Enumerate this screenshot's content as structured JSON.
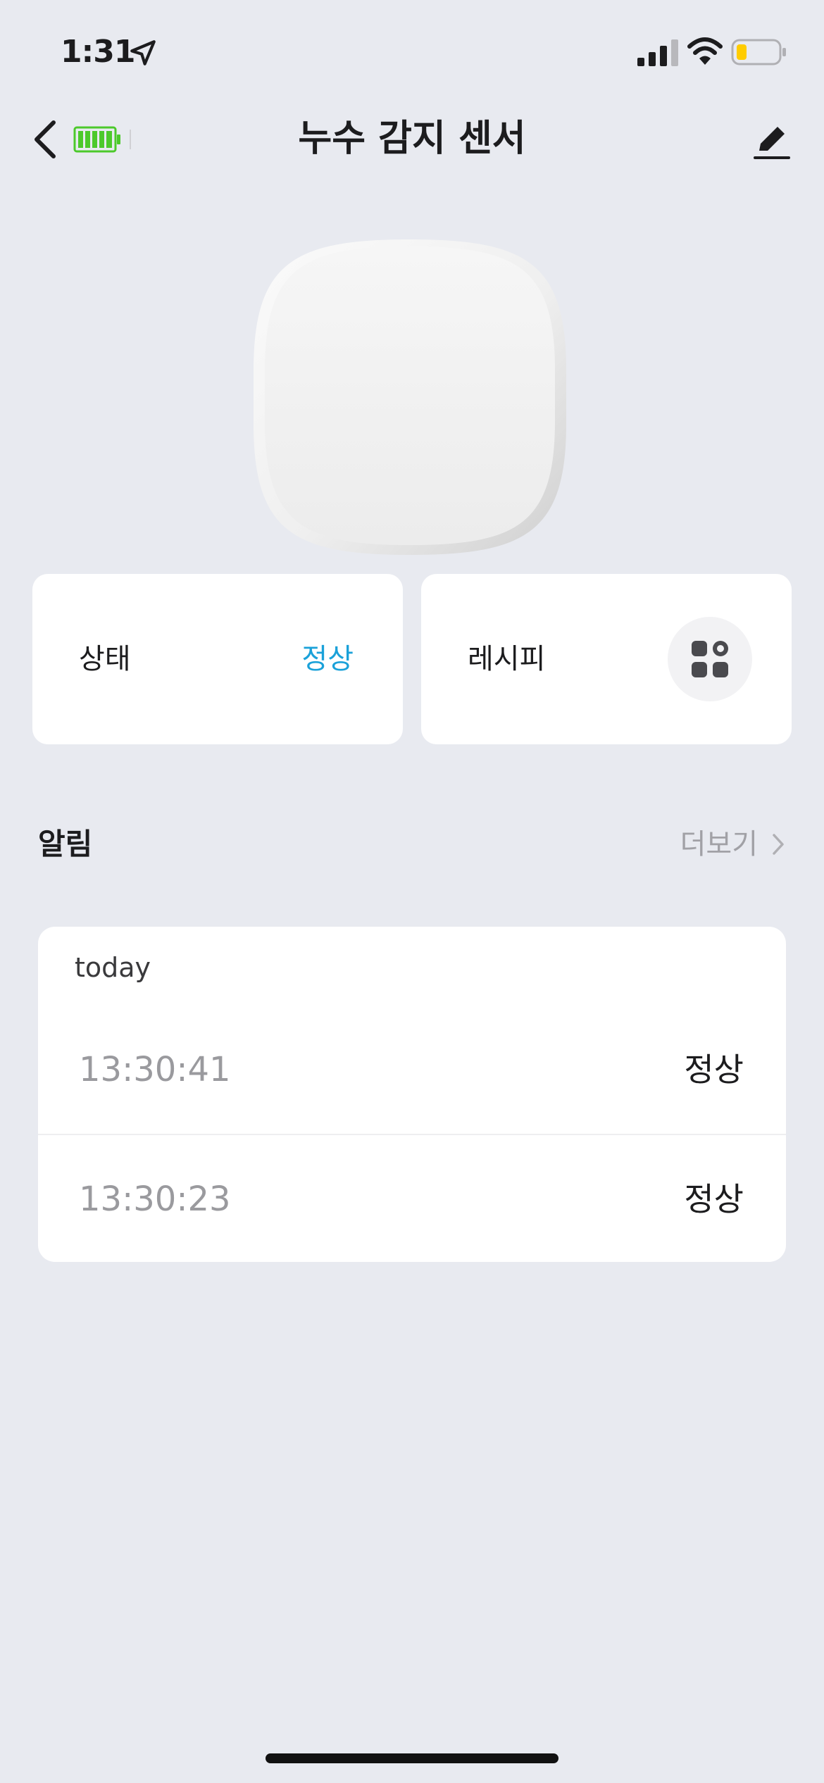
{
  "status_bar": {
    "time": "1:31"
  },
  "header": {
    "title": "누수 감지 센서"
  },
  "cards": {
    "status": {
      "label": "상태",
      "value": "정상",
      "value_color": "#1aa1d9"
    },
    "recipe": {
      "label": "레시피"
    }
  },
  "alerts": {
    "title": "알림",
    "more_label": "더보기",
    "group_label": "today",
    "items": [
      {
        "time": "13:30:41",
        "status": "정상"
      },
      {
        "time": "13:30:23",
        "status": "정상"
      }
    ]
  },
  "icons": {
    "location": "location-arrow-icon",
    "signal": "cellular-signal-icon",
    "wifi": "wifi-icon",
    "battery_status": "battery-low-icon",
    "back": "chevron-left-icon",
    "device_battery": "battery-full-icon",
    "edit": "pencil-icon",
    "recipe": "grid-apps-icon",
    "more": "chevron-right-icon"
  },
  "colors": {
    "background": "#e8eaf0",
    "accent": "#1aa1d9",
    "device_battery": "#4cc92b",
    "status_battery": "#ffcc00"
  }
}
